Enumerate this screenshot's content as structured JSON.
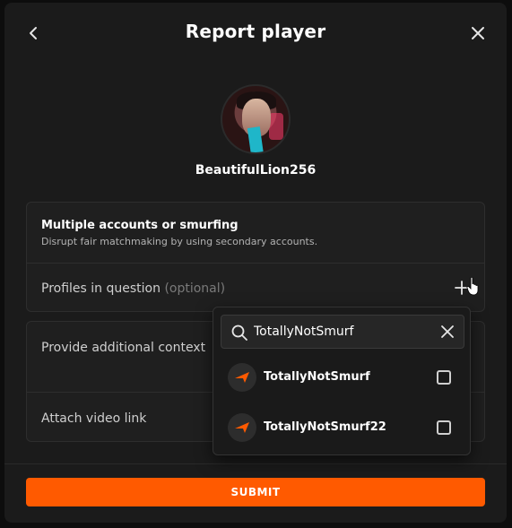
{
  "header": {
    "title": "Report player"
  },
  "player": {
    "username": "BeautifulLion256"
  },
  "reason": {
    "title": "Multiple accounts or smurfing",
    "description": "Disrupt fair matchmaking by using secondary accounts."
  },
  "profiles": {
    "label": "Profiles in question",
    "optional": "(optional)"
  },
  "context": {
    "label": "Provide additional context"
  },
  "video": {
    "label": "Attach video link"
  },
  "search": {
    "value": "TotallyNotSmurf"
  },
  "results": [
    {
      "name": "TotallyNotSmurf",
      "checked": false
    },
    {
      "name": "TotallyNotSmurf22",
      "checked": false
    }
  ],
  "footer": {
    "submit_label": "SUBMIT"
  },
  "colors": {
    "accent": "#ff5a00",
    "background": "#1b1b1b"
  }
}
